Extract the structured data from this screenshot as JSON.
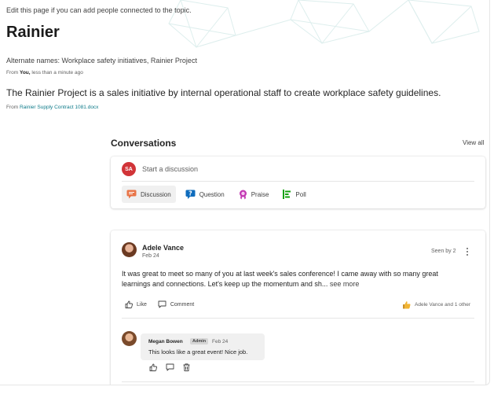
{
  "page": {
    "edit_hint": "Edit this page if you can add people connected to the topic.",
    "title": "Rainier",
    "alternate_names": "Alternate names: Workplace safety initiatives, Rainier Project",
    "from_prefix": "From",
    "from_user": "You,",
    "from_time": "less than a minute ago",
    "description": "The Rainier Project is a sales initiative by internal operational staff to create workplace safety guidelines.",
    "source_prefix": "From",
    "source_file": "Rainier Supply Contract 1081.docx"
  },
  "conversations": {
    "title": "Conversations",
    "view_all": "View all",
    "composer": {
      "avatar_initials": "SA",
      "avatar_color": "#d13438",
      "placeholder": "Start a discussion",
      "post_types": [
        {
          "label": "Discussion",
          "icon": "discussion-icon",
          "color": "#e97548",
          "active": true
        },
        {
          "label": "Question",
          "icon": "question-icon",
          "color": "#0f6cbd",
          "active": false
        },
        {
          "label": "Praise",
          "icon": "praise-icon",
          "color": "#c239b3",
          "active": false
        },
        {
          "label": "Poll",
          "icon": "poll-icon",
          "color": "#13a10e",
          "active": false
        }
      ]
    },
    "post": {
      "author": "Adele Vance",
      "date": "Feb 24",
      "seen_by": "Seen by 2",
      "body": "It was great to meet so many of you at last week's sales conference! I came away with so many great learnings and connections. Let's keep up the momentum and sh...",
      "see_more": "see more",
      "like_label": "Like",
      "comment_label": "Comment",
      "reactions_text": "Adele Vance and 1 other",
      "reply": {
        "author": "Megan Bowen",
        "badge": "Admin",
        "date": "Feb 24",
        "text": "This looks like a great event! Nice job."
      }
    }
  }
}
